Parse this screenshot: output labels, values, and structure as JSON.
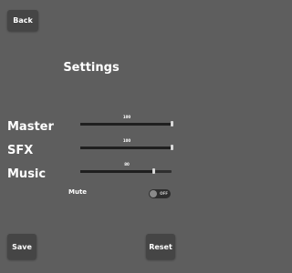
{
  "header": {
    "back_label": "Back"
  },
  "title": "Settings",
  "audio": {
    "master": {
      "label": "Master",
      "value": 100,
      "display": "100"
    },
    "sfx": {
      "label": "SFX",
      "value": 100,
      "display": "100"
    },
    "music": {
      "label": "Music",
      "value": 80,
      "display": "80"
    }
  },
  "mute": {
    "label": "Mute",
    "state": "OFF"
  },
  "footer": {
    "save_label": "Save",
    "reset_label": "Reset"
  }
}
